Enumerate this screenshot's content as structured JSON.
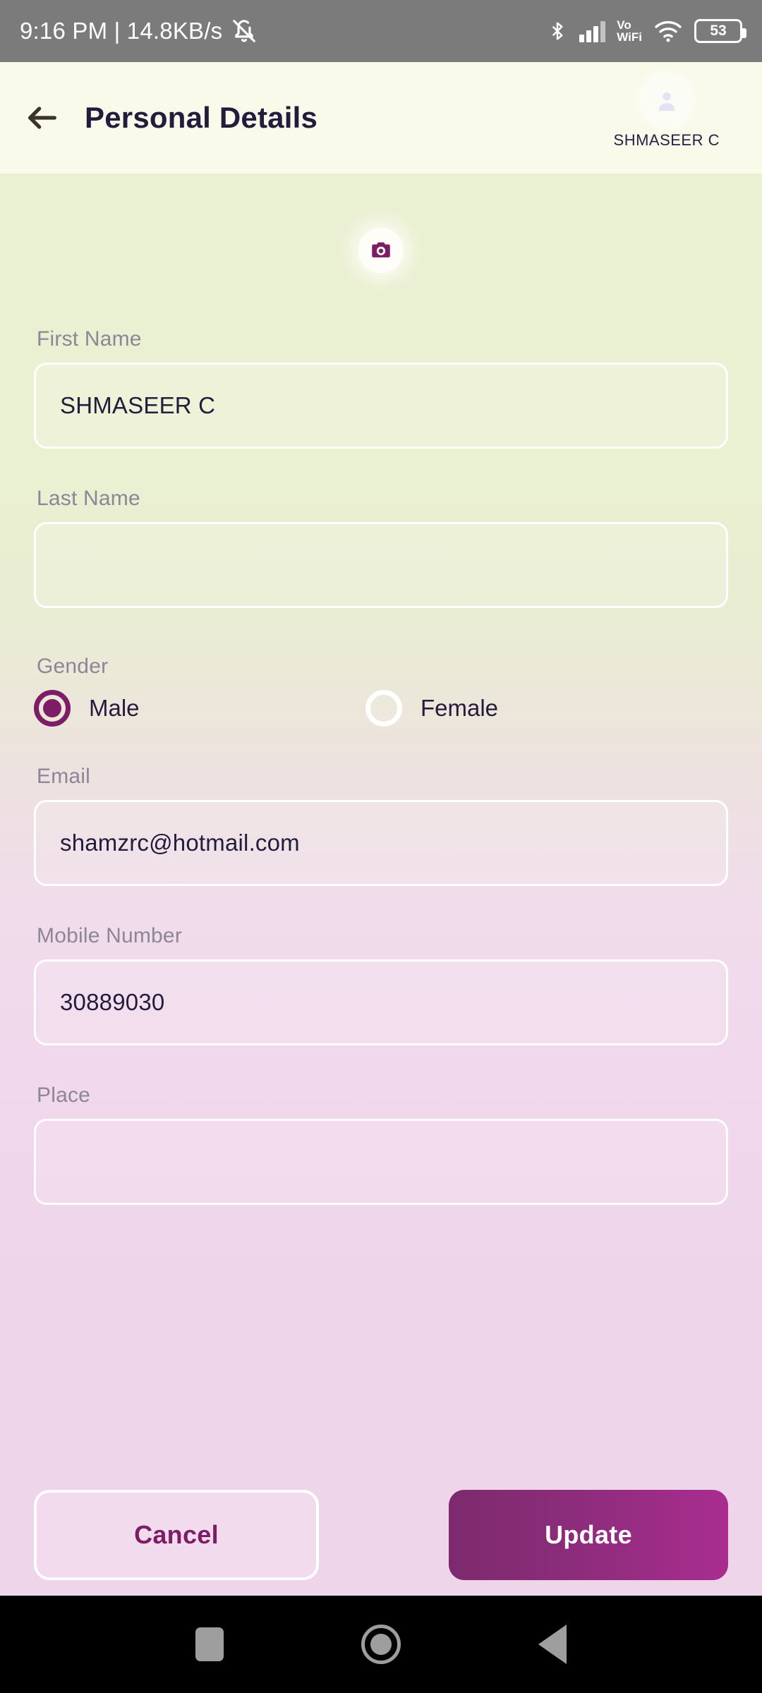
{
  "status_bar": {
    "time_and_speed": "9:16 PM | 14.8KB/s",
    "mute_icon": "bell-mute-icon",
    "bluetooth_icon": "bluetooth-icon",
    "signal_icon": "cellular-signal-icon",
    "vo_line1": "Vo",
    "vo_line2": "WiFi",
    "wifi_icon": "wifi-icon",
    "battery_level": "53"
  },
  "header": {
    "back_icon": "back-arrow-icon",
    "title": "Personal Details",
    "avatar_icon": "user-avatar-icon",
    "user_name": "SHMASEER C"
  },
  "profile": {
    "camera_icon": "camera-icon"
  },
  "form": {
    "first_name": {
      "label": "First Name",
      "value": "SHMASEER C",
      "placeholder": ""
    },
    "last_name": {
      "label": "Last Name",
      "value": "",
      "placeholder": ""
    },
    "gender": {
      "label": "Gender",
      "selected": "Male",
      "options": [
        {
          "label": "Male",
          "checked": true
        },
        {
          "label": "Female",
          "checked": false
        }
      ]
    },
    "email": {
      "label": "Email",
      "value": "shamzrc@hotmail.com",
      "placeholder": ""
    },
    "mobile": {
      "label": "Mobile Number",
      "value": "30889030",
      "placeholder": ""
    },
    "place": {
      "label": "Place",
      "value": "",
      "placeholder": ""
    }
  },
  "actions": {
    "cancel_label": "Cancel",
    "update_label": "Update"
  },
  "nav_bar": {
    "recents_icon": "recents-square-icon",
    "home_icon": "home-circle-icon",
    "back_icon": "back-triangle-icon"
  },
  "colors": {
    "accent_purple": "#7D1D66",
    "update_gradient_start": "#7C2A6D",
    "update_gradient_end": "#A92D8F",
    "header_bg": "#FAFAEB",
    "body_top": "#EAF0D2",
    "body_bottom": "#EFD5EA",
    "text_dark": "#241C3D",
    "label_gray": "#8C8696",
    "status_bar_bg": "#7B7B7B"
  }
}
